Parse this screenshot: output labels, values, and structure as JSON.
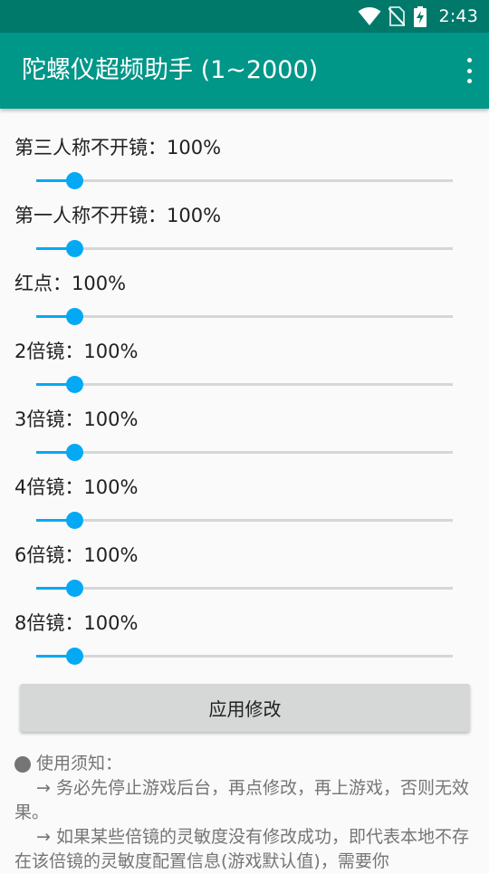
{
  "status_bar": {
    "time": "2:43",
    "icons": [
      "wifi-icon",
      "no-sim-icon",
      "battery-charging-icon"
    ]
  },
  "app_bar": {
    "title": "陀螺仪超频助手 (1~2000)",
    "menu_icon": "overflow-menu-icon"
  },
  "colors": {
    "status_bar": "#00796b",
    "app_bar": "#009688",
    "slider_accent": "#03a9f4",
    "slider_track": "#d6d6d6",
    "button_bg": "#d6d7d7"
  },
  "settings": [
    {
      "label": "第三人称不开镜：100%",
      "value": 100
    },
    {
      "label": "第一人称不开镜：100%",
      "value": 100
    },
    {
      "label": "红点：100%",
      "value": 100
    },
    {
      "label": "2倍镜：100%",
      "value": 100
    },
    {
      "label": "3倍镜：100%",
      "value": 100
    },
    {
      "label": "4倍镜：100%",
      "value": 100
    },
    {
      "label": "6倍镜：100%",
      "value": 100
    },
    {
      "label": "8倍镜：100%",
      "value": 100
    }
  ],
  "slider_range": {
    "min": 1,
    "max": 2000
  },
  "apply_button": {
    "label": "应用修改"
  },
  "notes": {
    "heading": "使用须知：",
    "lines": [
      "→ 务必先停止游戏后台，再点修改，再上游戏，否则无效果。",
      "→ 如果某些倍镜的灵敏度没有修改成功，即代表本地不存在该倍镜的灵敏度配置信息(游戏默认值)，需要你"
    ]
  }
}
